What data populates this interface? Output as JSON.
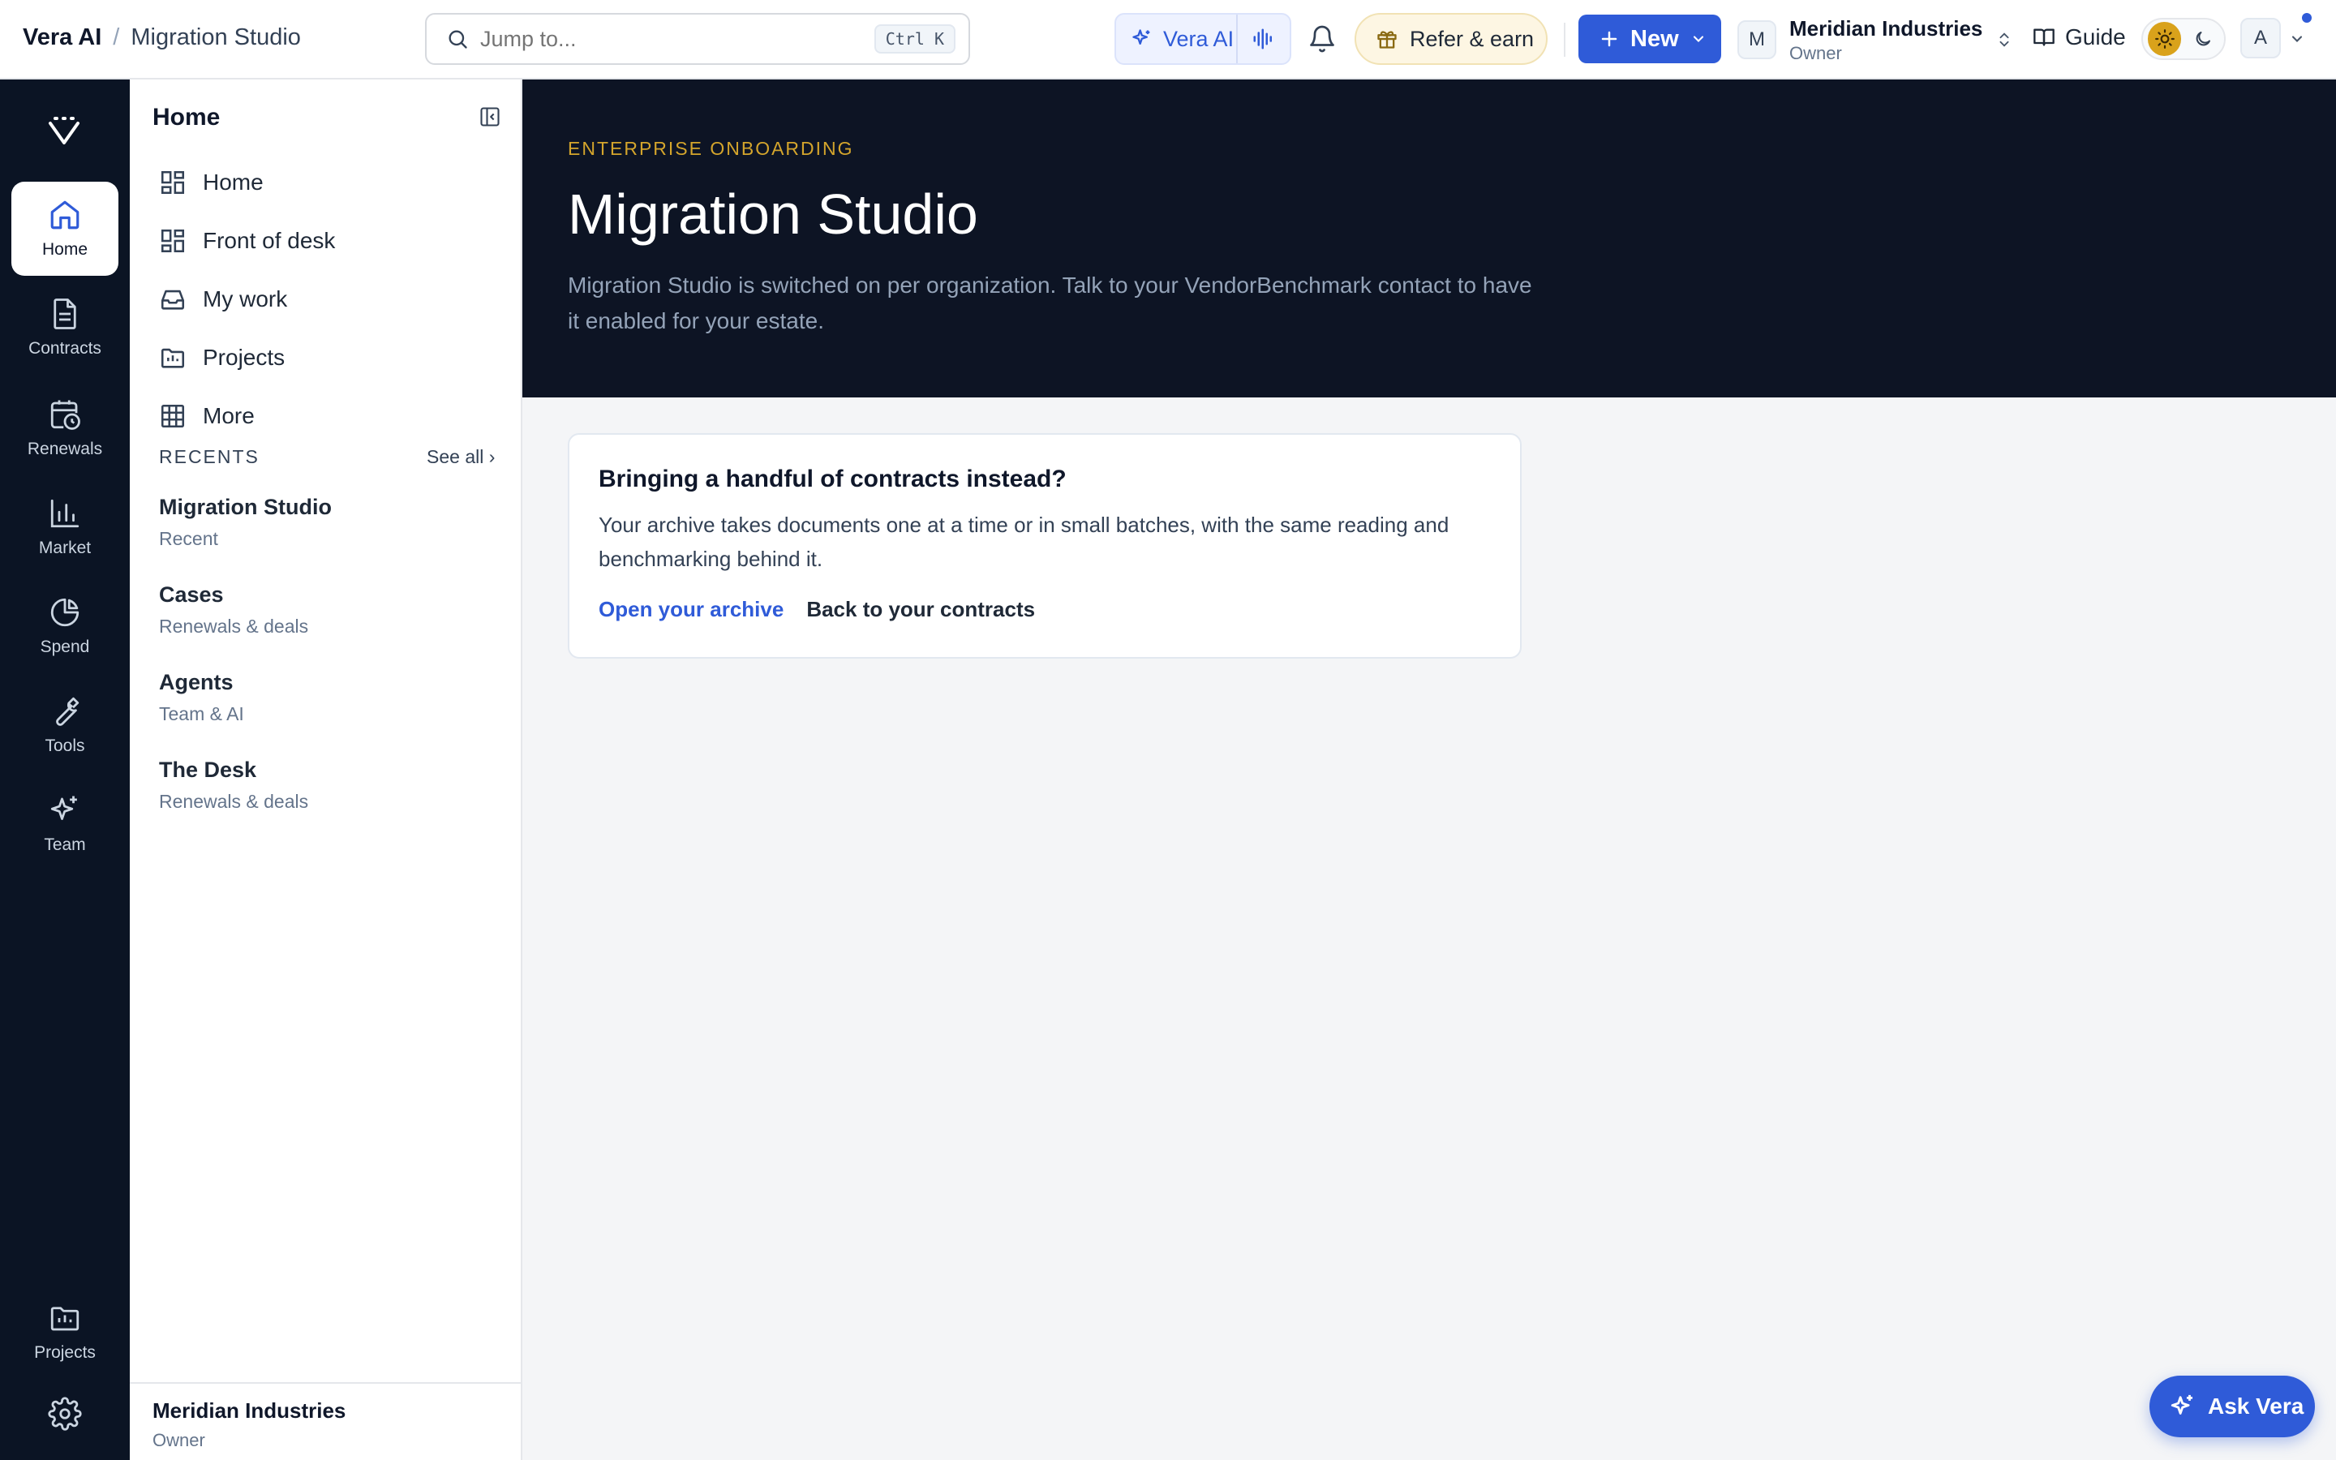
{
  "breadcrumb": {
    "app": "Vera AI",
    "separator": "/",
    "page": "Migration Studio"
  },
  "search": {
    "placeholder": "Jump to...",
    "shortcut": "Ctrl K"
  },
  "header": {
    "vera_label": "Vera AI",
    "refer_label": "Refer & earn",
    "new_label": "New",
    "org_initial": "M",
    "org_name": "Meridian Industries",
    "org_role": "Owner",
    "guide_label": "Guide",
    "user_initial": "A"
  },
  "rail": {
    "items": [
      {
        "label": "Home",
        "icon": "home-icon",
        "active": true
      },
      {
        "label": "Contracts",
        "icon": "document-icon"
      },
      {
        "label": "Renewals",
        "icon": "calendar-clock-icon"
      },
      {
        "label": "Market",
        "icon": "bar-chart-icon"
      },
      {
        "label": "Spend",
        "icon": "pie-chart-icon"
      },
      {
        "label": "Tools",
        "icon": "wrench-icon"
      },
      {
        "label": "Team",
        "icon": "sparkles-icon"
      }
    ],
    "projects_label": "Projects"
  },
  "sidebar": {
    "title": "Home",
    "nav": [
      {
        "label": "Home",
        "icon": "grid-icon"
      },
      {
        "label": "Front of desk",
        "icon": "grid-icon"
      },
      {
        "label": "My work",
        "icon": "inbox-icon"
      },
      {
        "label": "Projects",
        "icon": "folder-chart-icon"
      },
      {
        "label": "More",
        "icon": "table-icon"
      }
    ],
    "recents_label": "RECENTS",
    "see_all": "See all ›",
    "recents": [
      {
        "title": "Migration Studio",
        "subtitle": "Recent"
      },
      {
        "title": "Cases",
        "subtitle": "Renewals & deals"
      },
      {
        "title": "Agents",
        "subtitle": "Team & AI"
      },
      {
        "title": "The Desk",
        "subtitle": "Renewals & deals"
      }
    ],
    "footer": {
      "name": "Meridian Industries",
      "role": "Owner"
    }
  },
  "hero": {
    "eyebrow": "ENTERPRISE ONBOARDING",
    "title": "Migration Studio",
    "description": "Migration Studio is switched on per organization. Talk to your VendorBenchmark contact to have it enabled for your estate."
  },
  "card": {
    "title": "Bringing a handful of contracts instead?",
    "body": "Your archive takes documents one at a time or in small batches, with the same reading and benchmarking behind it.",
    "primary_link": "Open your archive",
    "secondary_link": "Back to your contracts"
  },
  "ask_vera": "Ask Vera",
  "colors": {
    "accent": "#2f5bd8",
    "rail_bg": "#0b1424",
    "hero_bg": "#0d1424",
    "eyebrow": "#d4a52c"
  }
}
